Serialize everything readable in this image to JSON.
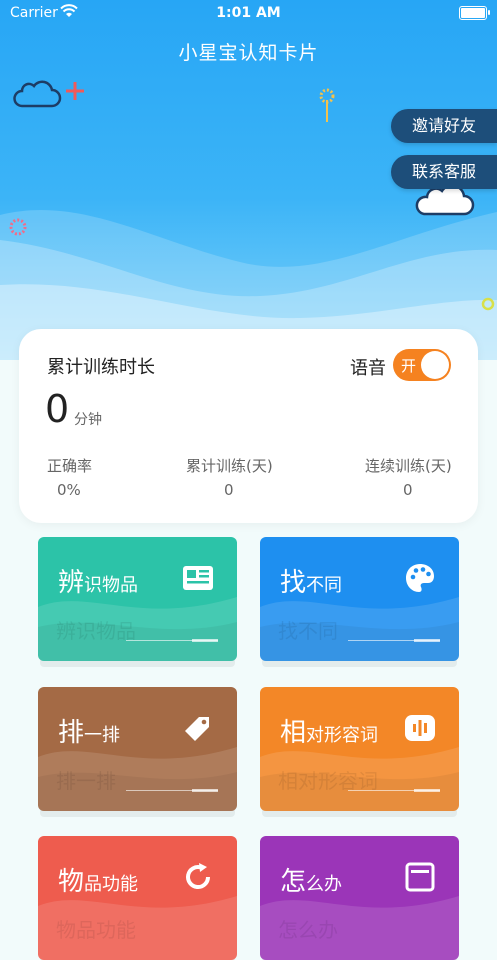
{
  "status": {
    "carrier": "Carrier",
    "time": "1:01 AM"
  },
  "app": {
    "title": "小星宝认知卡片"
  },
  "buttons": {
    "invite": "邀请好友",
    "service": "联系客服"
  },
  "stats": {
    "total_label": "累计训练时长",
    "total_value": "0",
    "total_unit": "分钟",
    "voice_label": "语音",
    "voice_toggle": "开",
    "accuracy_label": "正确率",
    "accuracy_value": "0%",
    "days_label": "累计训练(天)",
    "days_value": "0",
    "streak_label": "连续训练(天)",
    "streak_value": "0"
  },
  "tiles": [
    {
      "big": "辨",
      "small": "识物品",
      "ghost": "辨识物品",
      "color": "#2cc3a8",
      "icon": "newspaper-icon"
    },
    {
      "big": "找",
      "small": "不同",
      "ghost": "找不同",
      "color": "#1e8ff0",
      "icon": "palette-icon"
    },
    {
      "big": "排",
      "small": "一排",
      "ghost": "排一排",
      "color": "#a46a45",
      "icon": "tag-icon"
    },
    {
      "big": "相",
      "small": "对形容词",
      "ghost": "相对形容词",
      "color": "#f38727",
      "icon": "audio-icon"
    },
    {
      "big": "物",
      "small": "品功能",
      "ghost": "物品功能",
      "color": "#ee5c4e",
      "icon": "refresh-icon"
    },
    {
      "big": "怎",
      "small": "么办",
      "ghost": "怎么办",
      "color": "#9b35b8",
      "icon": "card-icon"
    }
  ]
}
